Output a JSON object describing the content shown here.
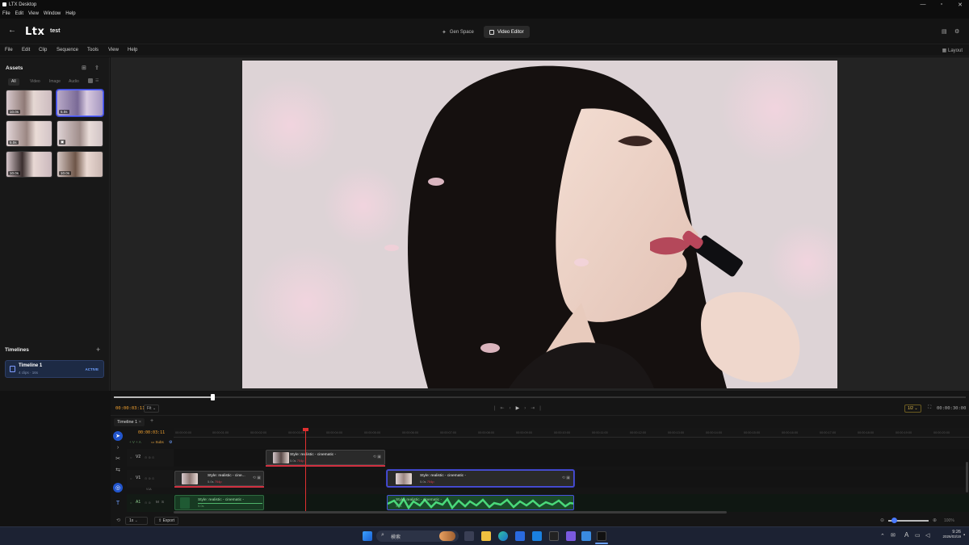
{
  "window": {
    "title": "LTX Desktop",
    "menu": [
      "File",
      "Edit",
      "View",
      "Window",
      "Help"
    ]
  },
  "header": {
    "logo": "Ltx",
    "project": "test",
    "modes": [
      {
        "label": "Gen Space"
      },
      {
        "label": "Video Editor"
      }
    ]
  },
  "app_menu": [
    "File",
    "Edit",
    "Clip",
    "Sequence",
    "Tools",
    "View",
    "Help"
  ],
  "layout_label": "Layout",
  "assets": {
    "title": "Assets",
    "filters": [
      "All",
      "Video",
      "Image",
      "Audio"
    ],
    "items": [
      {
        "duration": "10.0s"
      },
      {
        "duration": "5.0s"
      },
      {
        "duration": "5.0s"
      },
      {
        "duration": ""
      },
      {
        "duration": "10.0s"
      },
      {
        "duration": "10.0s"
      }
    ]
  },
  "timelines": {
    "title": "Timelines",
    "items": [
      {
        "name": "Timeline 1",
        "meta": "4 clips · 16s",
        "status": "ACTIVE"
      }
    ]
  },
  "transport": {
    "timecode": "00:00:03:11",
    "zoom": "Fit",
    "resolution": "1/2",
    "total_time": "00:00:30:00"
  },
  "timeline": {
    "tab": "Timeline 1",
    "timecode": "00:00:03:11",
    "subtitle_label": "Subs",
    "ruler": [
      "00:00:00:00",
      "00:00:01:00",
      "00:00:02:00",
      "00:00:03:00",
      "00:00:04:00",
      "00:00:05:00",
      "00:00:06:00",
      "00:00:07:00",
      "00:00:08:00",
      "00:00:09:00",
      "00:00:10:00",
      "00:00:11:00",
      "00:00:12:00",
      "00:00:13:00",
      "00:00:14:00",
      "00:00:15:00",
      "00:00:16:00",
      "00:00:17:00",
      "00:00:18:00",
      "00:00:19:00",
      "00:00:20:00"
    ],
    "tracks": [
      {
        "name": "V2"
      },
      {
        "name": "V1"
      },
      {
        "name": "A1",
        "m": "M",
        "s": "S"
      }
    ],
    "v1a_label": "V1A",
    "clips": {
      "v2": {
        "label": "Style: realistic - cinematic -",
        "dur": "5.0s",
        "res": "704p"
      },
      "v1a": {
        "label": "Style: realistic - cine...",
        "dur": "5.0s",
        "res": "704p"
      },
      "v1b": {
        "label": "Style: realistic - cinematic -",
        "dur": "5.0s",
        "res": "704p"
      },
      "a1a": {
        "label": "Style: realistic - cinematic -",
        "dur": "5.0s"
      },
      "a1b": {
        "label": "Style: realistic - cinematic -",
        "dur": "5.0s"
      }
    },
    "speed": "1x",
    "export_label": "Export",
    "zoom_pct": "100%"
  },
  "taskbar": {
    "search_label": "検索",
    "time": "9:26",
    "date": "2026/03/19",
    "ime": "A"
  }
}
